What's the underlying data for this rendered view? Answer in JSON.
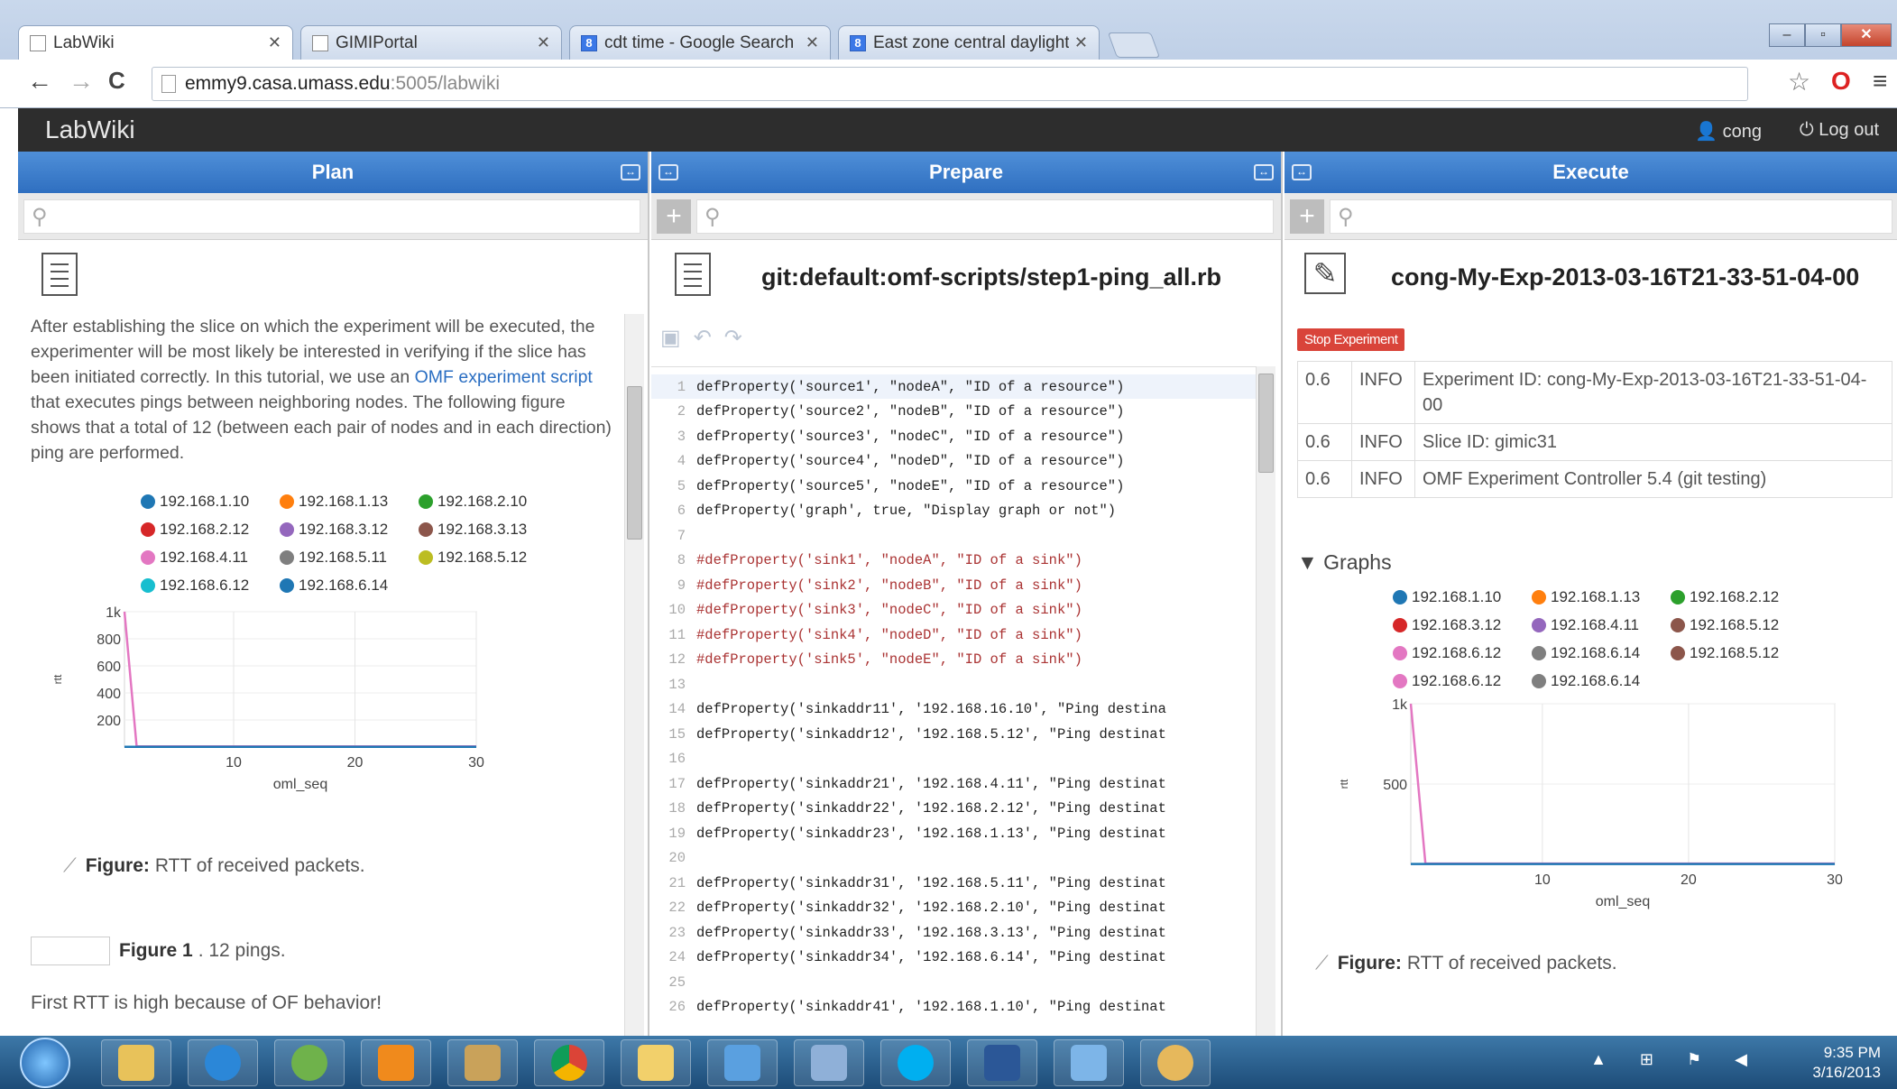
{
  "browser": {
    "tabs": [
      {
        "label": "LabWiki",
        "active": true
      },
      {
        "label": "GIMIPortal",
        "active": false
      },
      {
        "label": "cdt time - Google Search",
        "active": false
      },
      {
        "label": "East zone central daylight",
        "active": false
      }
    ],
    "url_host": "emmy9.casa.umass.edu",
    "url_path": ":5005/labwiki",
    "window_controls": {
      "minimize": "–",
      "maximize": "▫",
      "close": "✕"
    },
    "back": "←",
    "forward": "→",
    "reload": "C",
    "star": "☆",
    "opera": "O",
    "menu": "≡"
  },
  "labwiki": {
    "title": "LabWiki",
    "user": "cong",
    "logout": "Log out"
  },
  "plan": {
    "header": "Plan",
    "paragraph_pre": "After establishing the slice on which the experiment will be executed, the experimenter will be most likely be interested in verifying if the slice has been initiated correctly. In this tutorial, we use an ",
    "link": "OMF experiment script",
    "paragraph_post": " that executes pings between neighboring nodes. The following figure shows that a total of 12 (between each pair of nodes and in each direction) ping are performed.",
    "figure_label": "Figure:",
    "figure_caption": "RTT of received packets.",
    "figure1_label": "Figure 1",
    "figure1_caption": ". 12 pings.",
    "closing": "First RTT is high because of OF behavior!"
  },
  "plan_chart": {
    "chart_data": {
      "type": "line",
      "legend": [
        "192.168.1.10",
        "192.168.1.13",
        "192.168.2.10",
        "192.168.2.12",
        "192.168.3.12",
        "192.168.3.13",
        "192.168.4.11",
        "192.168.5.11",
        "192.168.5.12",
        "192.168.6.12",
        "192.168.6.14"
      ],
      "colors": [
        "#1f77b4",
        "#ff7f0e",
        "#2ca02c",
        "#d62728",
        "#9467bd",
        "#8c564b",
        "#e377c2",
        "#7f7f7f",
        "#bcbd22",
        "#17becf",
        "#1f77b4"
      ],
      "xlabel": "oml_seq",
      "ylabel": "rtt",
      "xticks": [
        "10",
        "20",
        "30"
      ],
      "yticks": [
        "200",
        "400",
        "600",
        "800",
        "1k"
      ],
      "xlim": [
        1,
        30
      ],
      "ylim": [
        0,
        1000
      ],
      "series": [
        {
          "name": "192.168.4.11",
          "x": [
            1,
            2,
            30
          ],
          "y": [
            1000,
            5,
            5
          ]
        },
        {
          "name": "192.168.6.14",
          "x": [
            1,
            30
          ],
          "y": [
            2,
            2
          ]
        }
      ]
    }
  },
  "prepare": {
    "header": "Prepare",
    "file": "git:default:omf-scripts/step1-ping_all.rb",
    "lines": [
      {
        "n": "1",
        "t": "defProperty('source1', \"nodeA\", \"ID of a resource\")"
      },
      {
        "n": "2",
        "t": "defProperty('source2', \"nodeB\", \"ID of a resource\")"
      },
      {
        "n": "3",
        "t": "defProperty('source3', \"nodeC\", \"ID of a resource\")"
      },
      {
        "n": "4",
        "t": "defProperty('source4', \"nodeD\", \"ID of a resource\")"
      },
      {
        "n": "5",
        "t": "defProperty('source5', \"nodeE\", \"ID of a resource\")"
      },
      {
        "n": "6",
        "t": "defProperty('graph', true, \"Display graph or not\")"
      },
      {
        "n": "7",
        "t": ""
      },
      {
        "n": "8",
        "t": "#defProperty('sink1', \"nodeA\", \"ID of a sink\")"
      },
      {
        "n": "9",
        "t": "#defProperty('sink2', \"nodeB\", \"ID of a sink\")"
      },
      {
        "n": "10",
        "t": "#defProperty('sink3', \"nodeC\", \"ID of a sink\")"
      },
      {
        "n": "11",
        "t": "#defProperty('sink4', \"nodeD\", \"ID of a sink\")"
      },
      {
        "n": "12",
        "t": "#defProperty('sink5', \"nodeE\", \"ID of a sink\")"
      },
      {
        "n": "13",
        "t": ""
      },
      {
        "n": "14",
        "t": "defProperty('sinkaddr11', '192.168.16.10', \"Ping destina"
      },
      {
        "n": "15",
        "t": "defProperty('sinkaddr12', '192.168.5.12', \"Ping destinat"
      },
      {
        "n": "16",
        "t": ""
      },
      {
        "n": "17",
        "t": "defProperty('sinkaddr21', '192.168.4.11', \"Ping destinat"
      },
      {
        "n": "18",
        "t": "defProperty('sinkaddr22', '192.168.2.12', \"Ping destinat"
      },
      {
        "n": "19",
        "t": "defProperty('sinkaddr23', '192.168.1.13', \"Ping destinat"
      },
      {
        "n": "20",
        "t": ""
      },
      {
        "n": "21",
        "t": "defProperty('sinkaddr31', '192.168.5.11', \"Ping destinat"
      },
      {
        "n": "22",
        "t": "defProperty('sinkaddr32', '192.168.2.10', \"Ping destinat"
      },
      {
        "n": "23",
        "t": "defProperty('sinkaddr33', '192.168.3.13', \"Ping destinat"
      },
      {
        "n": "24",
        "t": "defProperty('sinkaddr34', '192.168.6.14', \"Ping destinat"
      },
      {
        "n": "25",
        "t": ""
      },
      {
        "n": "26",
        "t": "defProperty('sinkaddr41', '192.168.1.10', \"Ping destinat"
      }
    ]
  },
  "execute": {
    "header": "Execute",
    "title": "cong-My-Exp-2013-03-16T21-33-51-04-00",
    "stop": "Stop Experiment",
    "log": [
      {
        "t": "0.6",
        "level": "INFO",
        "msg": "Experiment ID: cong-My-Exp-2013-03-16T21-33-51-04-00"
      },
      {
        "t": "0.6",
        "level": "INFO",
        "msg": "Slice ID: gimic31"
      },
      {
        "t": "0.6",
        "level": "INFO",
        "msg": "OMF Experiment Controller 5.4 (git testing)"
      }
    ],
    "graphs_header": "▼ Graphs",
    "figure_label": "Figure:",
    "figure_caption": "RTT of received packets."
  },
  "execute_chart": {
    "chart_data": {
      "type": "line",
      "legend": [
        "192.168.1.10",
        "192.168.1.13",
        "192.168.2.12",
        "192.168.3.12",
        "192.168.4.11",
        "192.168.5.12",
        "192.168.6.12",
        "192.168.6.14",
        "192.168.5.12",
        "192.168.6.12",
        "192.168.6.14"
      ],
      "colors": [
        "#1f77b4",
        "#ff7f0e",
        "#2ca02c",
        "#d62728",
        "#9467bd",
        "#8c564b",
        "#e377c2",
        "#7f7f7f",
        "#8c564b",
        "#e377c2",
        "#7f7f7f"
      ],
      "xlabel": "oml_seq",
      "ylabel": "rtt",
      "xticks": [
        "10",
        "20",
        "30"
      ],
      "yticks": [
        "500",
        "1k"
      ],
      "xlim": [
        1,
        30
      ],
      "ylim": [
        0,
        1000
      ],
      "series": [
        {
          "name": "192.168.6.12",
          "x": [
            1,
            2,
            30
          ],
          "y": [
            1000,
            5,
            5
          ]
        },
        {
          "name": "192.168.1.10",
          "x": [
            1,
            30
          ],
          "y": [
            2,
            2
          ]
        }
      ]
    }
  },
  "taskbar": {
    "time": "9:35 PM",
    "date": "3/16/2013",
    "tray": "▲ ⊞ ⚑ ◀"
  }
}
